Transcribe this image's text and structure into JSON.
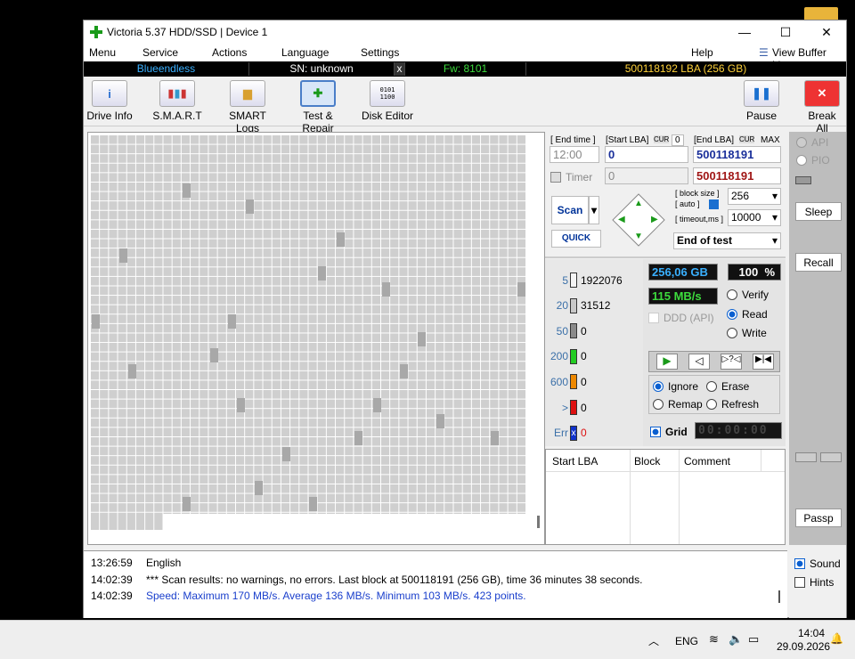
{
  "window": {
    "title": "Victoria 5.37 HDD/SSD | Device 1",
    "minimize": "—",
    "maximize": "☐",
    "close": "✕"
  },
  "menu": {
    "items": [
      "Menu",
      "Service",
      "Actions",
      "Language",
      "Settings"
    ],
    "help": "Help",
    "view_buffer": "View Buffer Live"
  },
  "info": {
    "model": "Blueendless",
    "serial": "SN: unknown",
    "close": "x",
    "firmware": "Fw: 8101",
    "lba": "500118192 LBA (256 GB)"
  },
  "toolbar": {
    "drive_info": "Drive Info",
    "smart": "S.M.A.R.T",
    "smart_logs": "SMART Logs",
    "test_repair": "Test & Repair",
    "disk_editor": "Disk Editor",
    "pause": "Pause",
    "break_all": "Break All"
  },
  "test": {
    "end_time_label": "[ End time ]",
    "start_lba_label": "[Start LBA]",
    "cur1": "CUR",
    "cur1_val": "0",
    "end_lba_label": "[End LBA]",
    "cur2": "CUR",
    "max": "MAX",
    "end_time": "12:00",
    "start_lba": "0",
    "end_lba": "500118191",
    "timer_label": "Timer",
    "timer_val": "0",
    "end_lba2": "500118191",
    "block_size_label": "[ block size ]",
    "auto_label": "[ auto ]",
    "block_size": "256",
    "timeout_label": "[ timeout,ms ]",
    "timeout": "10000",
    "scan": "Scan",
    "quick": "QUICK",
    "end_action": "End of test"
  },
  "stats": {
    "size": "256,06 GB",
    "percent": "100",
    "pct_sign": "%",
    "speed": "115 MB/s",
    "ddd": "DDD (API)",
    "verify": "Verify",
    "read": "Read",
    "write": "Write",
    "ignore": "Ignore",
    "erase": "Erase",
    "remap": "Remap",
    "refresh": "Refresh",
    "grid": "Grid",
    "clock": "00:00:00"
  },
  "legend": [
    {
      "label": "5",
      "count": "1922076",
      "color": "#f4f4f4"
    },
    {
      "label": "20",
      "count": "31512",
      "color": "#c8c8c8"
    },
    {
      "label": "50",
      "count": "0",
      "color": "#8a8a8a"
    },
    {
      "label": "200",
      "count": "0",
      "color": "#22cc22"
    },
    {
      "label": "600",
      "count": "0",
      "color": "#ee8800"
    },
    {
      "label": ">",
      "count": "0",
      "color": "#dd1111"
    },
    {
      "label": "Err",
      "count": "0",
      "color": "#1133cc",
      "glyph": "x"
    }
  ],
  "results": {
    "start_lba": "Start LBA",
    "block": "Block",
    "comment": "Comment"
  },
  "side": {
    "api": "API",
    "pio": "PIO",
    "sleep": "Sleep",
    "recall": "Recall",
    "passp": "Passp"
  },
  "log": [
    {
      "time": "13:26:59",
      "text": "English",
      "color": "#000"
    },
    {
      "time": "14:02:39",
      "text": "*** Scan results: no warnings, no errors. Last block at 500118191 (256 GB), time 36 minutes 38 seconds.",
      "color": "#000"
    },
    {
      "time": "14:02:39",
      "text": "Speed: Maximum 170 MB/s. Average 136 MB/s. Minimum 103 MB/s. 423 points.",
      "color": "#1a3fcc"
    }
  ],
  "log_side": {
    "sound": "Sound",
    "hints": "Hints"
  },
  "taskbar": {
    "lang": "ENG",
    "time": "14:04",
    "date": "29.09.2026"
  }
}
